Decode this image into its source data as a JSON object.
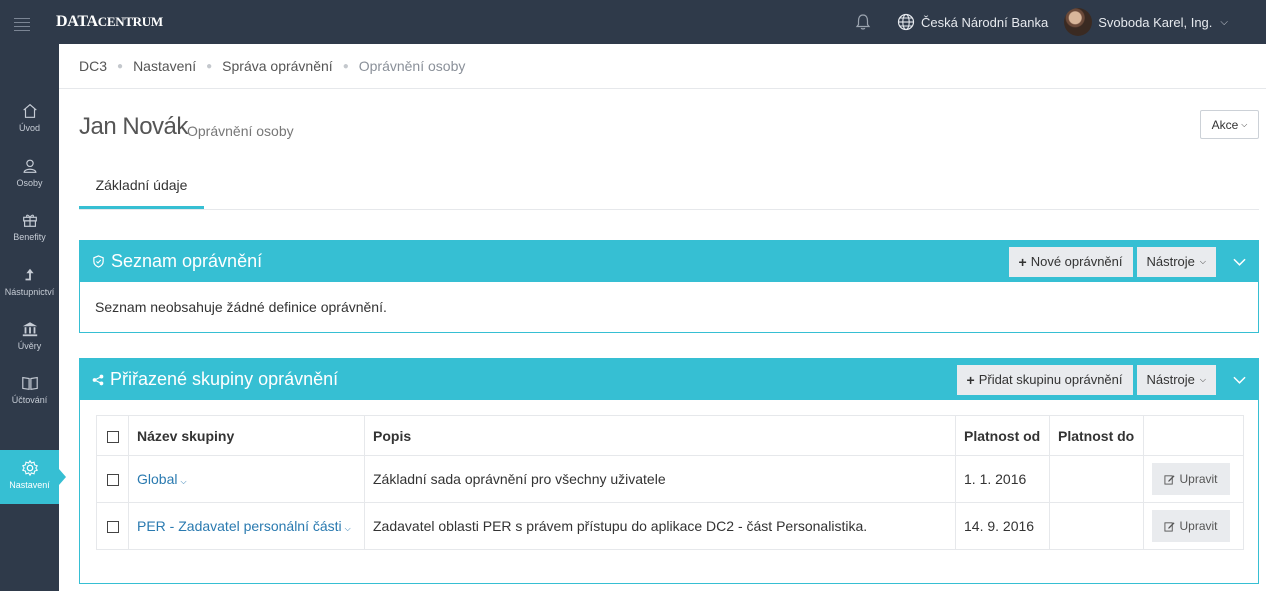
{
  "app": {
    "logo_main": "DATA",
    "logo_rest": "CENTRUM"
  },
  "topbar": {
    "organization": "Česká Národní Banka",
    "user_name": "Svoboda Karel, Ing."
  },
  "sidebar": {
    "items": [
      {
        "label": "Úvod",
        "icon": "home-icon"
      },
      {
        "label": "Osoby",
        "icon": "people-icon"
      },
      {
        "label": "Benefity",
        "icon": "gift-icon"
      },
      {
        "label": "Nástupnictví",
        "icon": "arrow-up-icon"
      },
      {
        "label": "Úvěry",
        "icon": "bank-icon"
      },
      {
        "label": "Účtování",
        "icon": "book-icon"
      },
      {
        "label": "Nastavení",
        "icon": "gear-icon",
        "active": true
      }
    ]
  },
  "breadcrumb": {
    "items": [
      "DC3",
      "Nastavení",
      "Správa oprávnění"
    ],
    "current": "Oprávnění osoby"
  },
  "page": {
    "title": "Jan Novák",
    "subtitle": "Oprávnění osoby",
    "actions_label": "Akce"
  },
  "tabs": [
    {
      "label": "Základní údaje",
      "active": true
    }
  ],
  "panel_permissions": {
    "title": "Seznam oprávnění",
    "new_button": "Nové oprávnění",
    "tools_button": "Nástroje",
    "empty_text": "Seznam neobsahuje žádné definice oprávnění."
  },
  "panel_groups": {
    "title": "Přiřazené skupiny oprávnění",
    "add_button": "Přidat skupinu oprávnění",
    "tools_button": "Nástroje",
    "columns": [
      "Název skupiny",
      "Popis",
      "Platnost od",
      "Platnost do"
    ],
    "rows": [
      {
        "name": "Global",
        "description": "Základní sada oprávnění pro všechny uživatele",
        "valid_from": "1. 1. 2016",
        "valid_to": "",
        "edit_label": "Upravit"
      },
      {
        "name": "PER - Zadavatel personální části",
        "description": "Zadavatel oblasti PER s právem přístupu do aplikace DC2 - část Personalistika.",
        "valid_from": "14. 9. 2016",
        "valid_to": "",
        "edit_label": "Upravit"
      }
    ]
  },
  "colors": {
    "accent": "#36bfd3",
    "topbar": "#2f3a4a",
    "link": "#2a7ab0"
  }
}
